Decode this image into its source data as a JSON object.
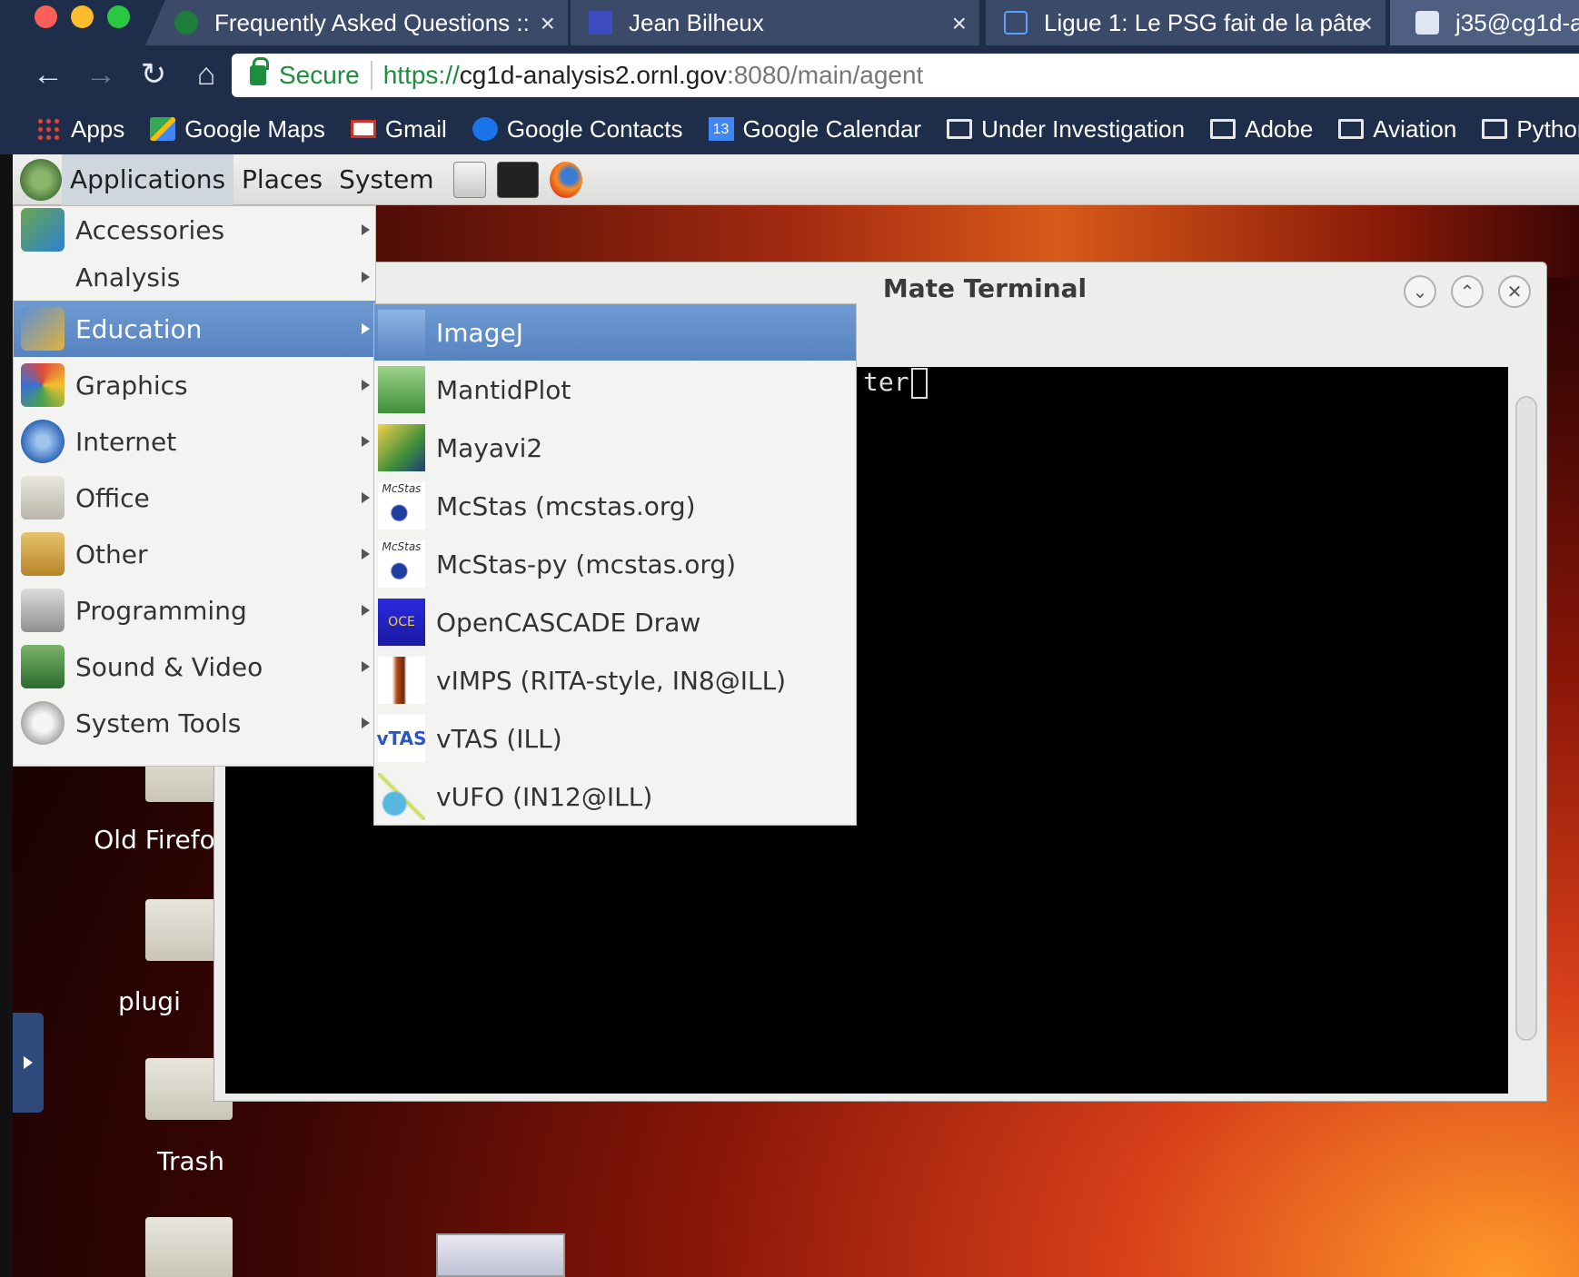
{
  "browser": {
    "tabs": [
      {
        "title": "Frequently Asked Questions ::",
        "close": "×",
        "state": "inactive"
      },
      {
        "title": "Jean Bilheux",
        "close": "×",
        "state": "inactive"
      },
      {
        "title": "Ligue 1: Le PSG fait de la pâte",
        "close": "×",
        "state": "inactive"
      },
      {
        "title": "j35@cg1d-a",
        "close": "",
        "state": "active"
      }
    ],
    "nav": {
      "back": "←",
      "forward": "→",
      "reload": "↻",
      "home": "⌂"
    },
    "address": {
      "secure_label": "Secure",
      "scheme": "https://",
      "host": "cg1d-analysis2.ornl.gov",
      "rest": ":8080/main/agent"
    },
    "bookmarks": [
      {
        "label": "Apps",
        "icon": "apps-grid-icon"
      },
      {
        "label": "Google Maps",
        "icon": "google-maps-icon"
      },
      {
        "label": "Gmail",
        "icon": "gmail-icon"
      },
      {
        "label": "Google Contacts",
        "icon": "contacts-icon"
      },
      {
        "label": "Google Calendar",
        "icon": "calendar-icon",
        "badge": "13"
      },
      {
        "label": "Under Investigation",
        "icon": "folder-icon"
      },
      {
        "label": "Adobe",
        "icon": "folder-icon"
      },
      {
        "label": "Aviation",
        "icon": "folder-icon"
      },
      {
        "label": "Python",
        "icon": "folder-icon"
      }
    ]
  },
  "panel": {
    "menus": [
      "Applications",
      "Places",
      "System"
    ]
  },
  "applications_menu": [
    {
      "label": "Accessories",
      "icon": "accessories-icon"
    },
    {
      "label": "Analysis",
      "icon": ""
    },
    {
      "label": "Education",
      "icon": "education-icon",
      "selected": true
    },
    {
      "label": "Graphics",
      "icon": "graphics-icon"
    },
    {
      "label": "Internet",
      "icon": "internet-icon"
    },
    {
      "label": "Office",
      "icon": "office-icon"
    },
    {
      "label": "Other",
      "icon": "other-icon"
    },
    {
      "label": "Programming",
      "icon": "programming-icon"
    },
    {
      "label": "Sound & Video",
      "icon": "sound-video-icon"
    },
    {
      "label": "System Tools",
      "icon": "system-tools-icon"
    }
  ],
  "education_menu": [
    {
      "label": "ImageJ",
      "icon": "imagej-icon",
      "selected": true
    },
    {
      "label": "MantidPlot",
      "icon": "mantidplot-icon"
    },
    {
      "label": "Mayavi2",
      "icon": "mayavi-icon"
    },
    {
      "label": "McStas (mcstas.org)",
      "icon": "mcstas-icon"
    },
    {
      "label": "McStas-py (mcstas.org)",
      "icon": "mcstas-py-icon"
    },
    {
      "label": "OpenCASCADE Draw",
      "icon": "opencascade-icon"
    },
    {
      "label": "vIMPS (RITA-style, IN8@ILL)",
      "icon": "vimps-icon"
    },
    {
      "label": "vTAS (ILL)",
      "icon": "vtas-icon"
    },
    {
      "label": "vUFO (IN12@ILL)",
      "icon": "vufo-icon"
    }
  ],
  "terminal": {
    "title": "Mate Terminal",
    "visible_text": "ter"
  },
  "desktop_icons": [
    {
      "label": "Old Firefo"
    },
    {
      "label": "plugi"
    },
    {
      "label": "Trash"
    }
  ],
  "icon_text": {
    "oce": "OCE",
    "vtas": "vTAS",
    "mcstas": "McStas"
  }
}
